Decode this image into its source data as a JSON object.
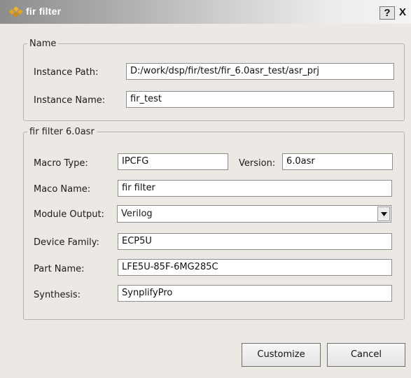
{
  "window": {
    "title": "fir filter",
    "help_label": "?",
    "close_label": "X"
  },
  "name_group": {
    "legend": "Name",
    "instance_path_label": "Instance Path:",
    "instance_path_value": "D:/work/dsp/fir/test/fir_6.0asr_test/asr_prj",
    "instance_name_label": "Instance Name:",
    "instance_name_value": "fir_test"
  },
  "fir_group": {
    "legend": "fir filter 6.0asr",
    "macro_type_label": "Macro Type:",
    "macro_type_value": "IPCFG",
    "version_label": "Version:",
    "version_value": "6.0asr",
    "maco_name_label": "Maco Name:",
    "maco_name_value": "fir filter",
    "module_output_label": "Module Output:",
    "module_output_value": "Verilog",
    "device_family_label": "Device Family:",
    "device_family_value": "ECP5U",
    "part_name_label": "Part Name:",
    "part_name_value": "LFE5U-85F-6MG285C",
    "synthesis_label": "Synthesis:",
    "synthesis_value": "SynplifyPro"
  },
  "buttons": {
    "customize": "Customize",
    "cancel": "Cancel"
  },
  "icons": {
    "app": "diamond-logo-icon",
    "dropdown": "chevron-down-icon"
  },
  "colors": {
    "icon_orange": "#e8a21a",
    "window_bg": "#ece9e4"
  }
}
